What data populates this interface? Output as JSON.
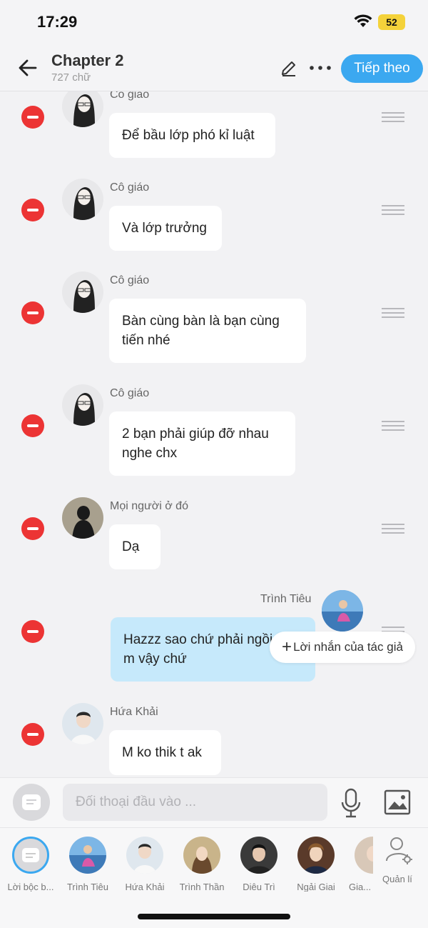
{
  "status_bar": {
    "time": "17:29",
    "battery": "52"
  },
  "header": {
    "title": "Chapter 2",
    "word_count": "727 chữ",
    "next_label": "Tiếp theo"
  },
  "messages": [
    {
      "name": "Cô giáo",
      "text": "Để bầu lớp phó kỉ luật",
      "side": "left"
    },
    {
      "name": "Cô giáo",
      "text": "Và lớp trưởng",
      "side": "left"
    },
    {
      "name": "Cô giáo",
      "text": "Bàn cùng bàn là bạn cùng tiến nhé",
      "side": "left"
    },
    {
      "name": "Cô giáo",
      "text": "2 bạn phải giúp đỡ nhau nghe chx",
      "side": "left"
    },
    {
      "name": "Mọi người ở đó",
      "text": "Dạ",
      "side": "left"
    },
    {
      "name": "Trình Tiêu",
      "text": "Hazzz sao chứ phải ngồi kế m vậy chứ",
      "side": "right"
    },
    {
      "name": "Hứa Khải",
      "text": "M ko thik t ak",
      "side": "left"
    }
  ],
  "author_note_label": "Lời nhắn của tác giả",
  "input": {
    "placeholder": "Đối thoại đầu vào ..."
  },
  "characters": [
    {
      "label": "Lời bộc b..."
    },
    {
      "label": "Trình Tiêu"
    },
    {
      "label": "Hứa Khải"
    },
    {
      "label": "Trình Thần"
    },
    {
      "label": "Diêu Trì"
    },
    {
      "label": "Ngải Giai"
    },
    {
      "label": "Gia..."
    }
  ],
  "manage_label": "Quản lí",
  "colors": {
    "accent": "#3ba8f0",
    "delete": "#ec3434",
    "my_bubble": "#c6e9fb"
  }
}
